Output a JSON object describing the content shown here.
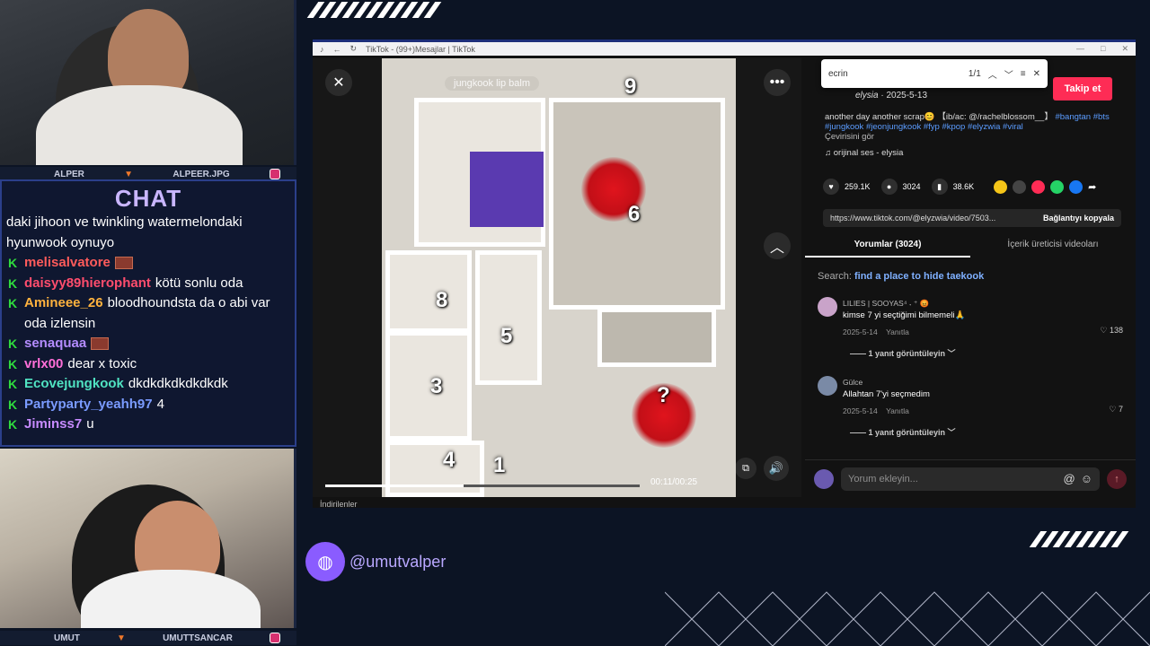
{
  "top_cam": {
    "name_left": "ALPER",
    "name_right": "ALPEER.JPG"
  },
  "bottom_cam": {
    "name_left": "UMUT",
    "name_right": "UMUTTSANCAR"
  },
  "chat": {
    "title": "CHAT",
    "overflow_text": "daki jihoon ve twinkling watermelondaki hyunwook oynuyo",
    "messages": [
      {
        "user": "melisalvatore",
        "color": "#ff5b5b",
        "text": "",
        "emote": true
      },
      {
        "user": "daisyy89hierophant",
        "color": "#ff4d6d",
        "text": "kötü sonlu oda",
        "emote": false
      },
      {
        "user": "Amineee_26",
        "color": "#ffb23e",
        "text": "bloodhoundsta da o abi var oda izlensin",
        "emote": false
      },
      {
        "user": "senaquaa",
        "color": "#b48cff",
        "text": "",
        "emote": true
      },
      {
        "user": "vrlx00",
        "color": "#ff6fd8",
        "text": "dear x toxic",
        "emote": false
      },
      {
        "user": "Ecovejungkook",
        "color": "#50e3c2",
        "text": "dkdkdkdkdkdkdk",
        "emote": false
      },
      {
        "user": "Partyparty_yeahh97",
        "color": "#7a9bff",
        "text": "4",
        "emote": false
      },
      {
        "user": "Jiminss7",
        "color": "#c78bff",
        "text": "u",
        "emote": false
      }
    ]
  },
  "browser": {
    "tab_title": "TikTok - (99+)Mesajlar | TikTok",
    "status_text": "İndirilenler"
  },
  "video": {
    "overlay_text": "jungkook lip balm",
    "room_numbers": [
      "9",
      "6",
      "8",
      "5",
      "3",
      "?",
      "4",
      "1"
    ],
    "timecode": "00:11/00:25",
    "progress": 0.44
  },
  "find_bar": {
    "query": "ecrin",
    "count": "1/1"
  },
  "post": {
    "follow_label": "Takip et",
    "author": "elysia",
    "date": "2025-5-13",
    "caption": "another day another scrap😊 【ib/ac: @/rachelblossom__】",
    "hashtags": "#bangtan #bts #jungkook #jeonjungkook #fyp #kpop #elyzwia #viral",
    "translate": "Çevirisini gör",
    "sound": "orijinal ses - elysia",
    "likes": "259.1K",
    "comments": "3024",
    "saves": "38.6K",
    "url": "https://www.tiktok.com/@elyzwia/video/7503...",
    "copy_label": "Bağlantıyı kopyala"
  },
  "tabs": {
    "comments_tab": "Yorumlar (3024)",
    "creator_tab": "İçerik üreticisi videoları"
  },
  "search_hint": {
    "prefix": "Search:",
    "query": "find a place to hide taekook"
  },
  "comments": [
    {
      "user": "LILIES | SOOYAS⁴ ˖ ⁺ 😡",
      "text": "kimse 7 yi seçtiğimi bilmemeli🙏",
      "date": "2025-5-14",
      "reply": "Yanıtla",
      "likes": "138",
      "view_replies": "1 yanıt görüntüleyin"
    },
    {
      "user": "Gülce",
      "text": "Allahtan 7'yi seçmedim",
      "date": "2025-5-14",
      "reply": "Yanıtla",
      "likes": "7",
      "view_replies": "1 yanıt görüntüleyin"
    }
  ],
  "composer": {
    "placeholder": "Yorum ekleyin..."
  },
  "footer": {
    "handle": "@umutvalper"
  }
}
